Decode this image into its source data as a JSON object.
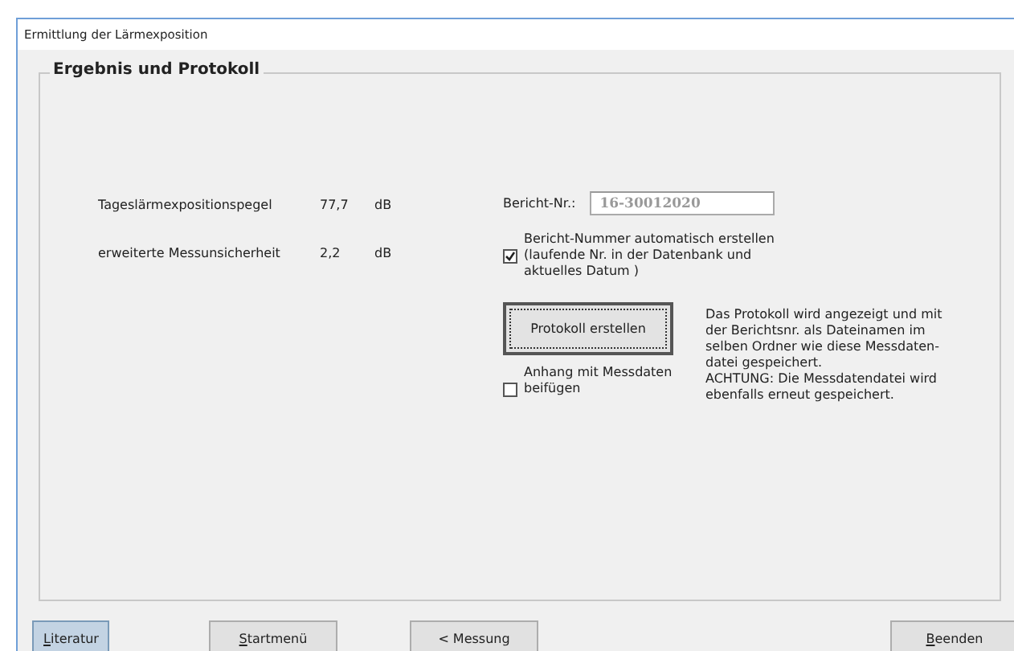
{
  "window": {
    "title": "Ermittlung der Lärmexposition"
  },
  "group": {
    "title": "Ergebnis und Protokoll"
  },
  "results": [
    {
      "label": "Tageslärmexpositionspegel",
      "value": "77,7",
      "unit": "dB"
    },
    {
      "label": "erweiterte Messunsicherheit",
      "value": "2,2",
      "unit": "dB"
    }
  ],
  "report_number": {
    "label": "Bericht-Nr.:",
    "value": "16-30012020",
    "disabled": true
  },
  "auto_number": {
    "label": "Bericht-Nummer automatisch erstellen (laufende Nr. in der Datenbank und aktuelles Datum )",
    "checked": true
  },
  "create_button": {
    "label": "Protokoll erstellen"
  },
  "attachment": {
    "label": "Anhang mit Messdaten beifügen",
    "checked": false
  },
  "info": [
    "Das Protokoll wird angezeigt und mit der Berichtsnr. als Dateinamen im selben Ordner wie diese Messdaten-datei gespeichert.",
    "ACHTUNG: Die Messdatendatei wird ebenfalls erneut gespeichert."
  ],
  "buttons": [
    {
      "label": "Literatur",
      "access_key_underlined": true,
      "selected": true
    },
    {
      "label": "Startmenü",
      "access_key_underlined": true,
      "selected": false
    },
    {
      "label": "< Messung",
      "access_key_underlined": false,
      "selected": false
    },
    {
      "label": "Beenden",
      "access_key_underlined": true,
      "selected": false
    }
  ]
}
